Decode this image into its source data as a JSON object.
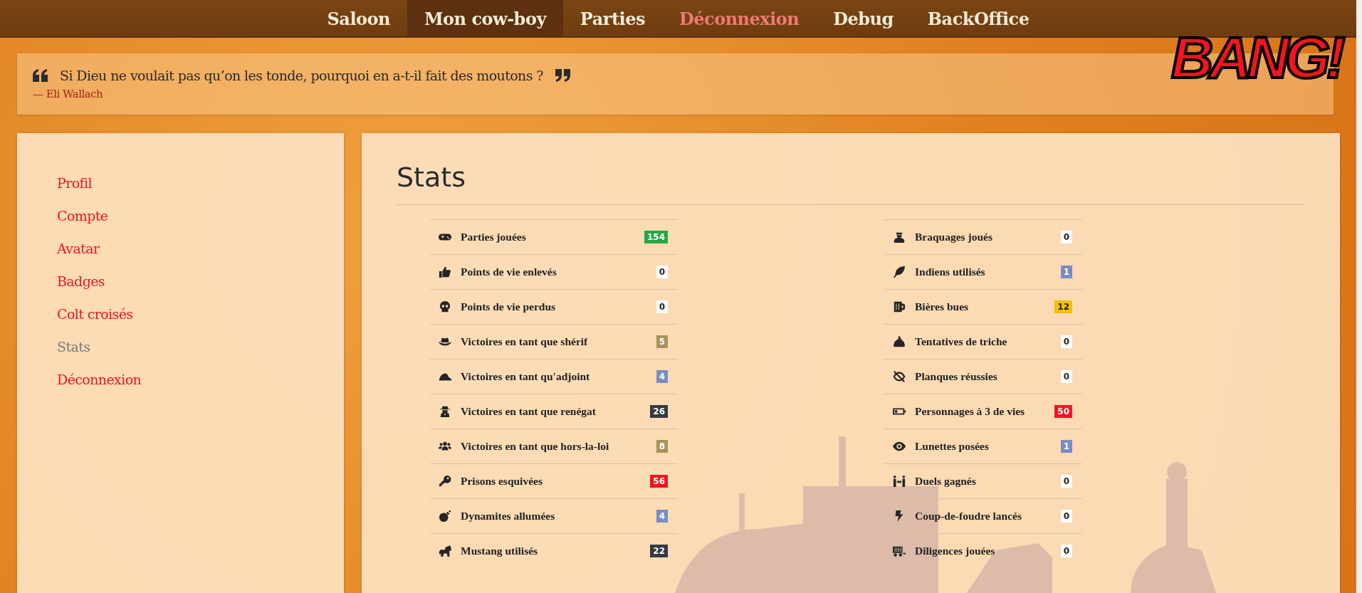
{
  "nav": {
    "items": [
      {
        "label": "Saloon",
        "selected": false,
        "kind": "link"
      },
      {
        "label": "Mon cow-boy",
        "selected": true,
        "kind": "link"
      },
      {
        "label": "Parties",
        "selected": false,
        "kind": "link"
      },
      {
        "label": "Déconnexion",
        "selected": false,
        "kind": "danger"
      },
      {
        "label": "Debug",
        "selected": false,
        "kind": "link"
      },
      {
        "label": "BackOffice",
        "selected": false,
        "kind": "link"
      }
    ]
  },
  "logo": {
    "text": "BANG!"
  },
  "quote": {
    "text": "Si Dieu ne voulait pas qu’on les tonde, pourquoi en a-t-il fait des moutons ?",
    "author": "— Eli Wallach"
  },
  "sidebar": {
    "items": [
      {
        "label": "Profil",
        "selected": false
      },
      {
        "label": "Compte",
        "selected": false
      },
      {
        "label": "Avatar",
        "selected": false
      },
      {
        "label": "Badges",
        "selected": false
      },
      {
        "label": "Colt croisés",
        "selected": false
      },
      {
        "label": "Stats",
        "selected": true
      },
      {
        "label": "Déconnexion",
        "selected": false
      }
    ]
  },
  "main": {
    "title": "Stats",
    "columns": [
      [
        {
          "label": "Parties jouées",
          "value": "154",
          "color": "#28a745"
        },
        {
          "label": "Points de vie enlevés",
          "value": "0",
          "color": "#ffffff"
        },
        {
          "label": "Points de vie perdus",
          "value": "0",
          "color": "#ffffff"
        },
        {
          "label": "Victoires en tant que shérif",
          "value": "5",
          "color": "#a8935a"
        },
        {
          "label": "Victoires en tant qu'adjoint",
          "value": "4",
          "color": "#7a8cc4"
        },
        {
          "label": "Victoires en tant que renégat",
          "value": "26",
          "color": "#343a40"
        },
        {
          "label": "Victoires en tant que hors-la-loi",
          "value": "8",
          "color": "#a8935a"
        },
        {
          "label": "Prisons esquivées",
          "value": "56",
          "color": "#f01520"
        },
        {
          "label": "Dynamites allumées",
          "value": "4",
          "color": "#7a8cc4"
        },
        {
          "label": "Mustang utilisés",
          "value": "22",
          "color": "#343a40"
        }
      ],
      [
        {
          "label": "Braquages joués",
          "value": "0",
          "color": "#ffffff"
        },
        {
          "label": "Indiens utilisés",
          "value": "1",
          "color": "#7a8cc4"
        },
        {
          "label": "Bières bues",
          "value": "12",
          "color": "#f5c000"
        },
        {
          "label": "Tentatives de triche",
          "value": "0",
          "color": "#ffffff"
        },
        {
          "label": "Planques réussies",
          "value": "0",
          "color": "#ffffff"
        },
        {
          "label": "Personnages à 3 de vies",
          "value": "50",
          "color": "#f01520"
        },
        {
          "label": "Lunettes posées",
          "value": "1",
          "color": "#7a8cc4"
        },
        {
          "label": "Duels gagnés",
          "value": "0",
          "color": "#ffffff"
        },
        {
          "label": "Coup-de-foudre lancés",
          "value": "0",
          "color": "#ffffff"
        },
        {
          "label": "Diligences jouées",
          "value": "0",
          "color": "#ffffff"
        }
      ]
    ]
  }
}
